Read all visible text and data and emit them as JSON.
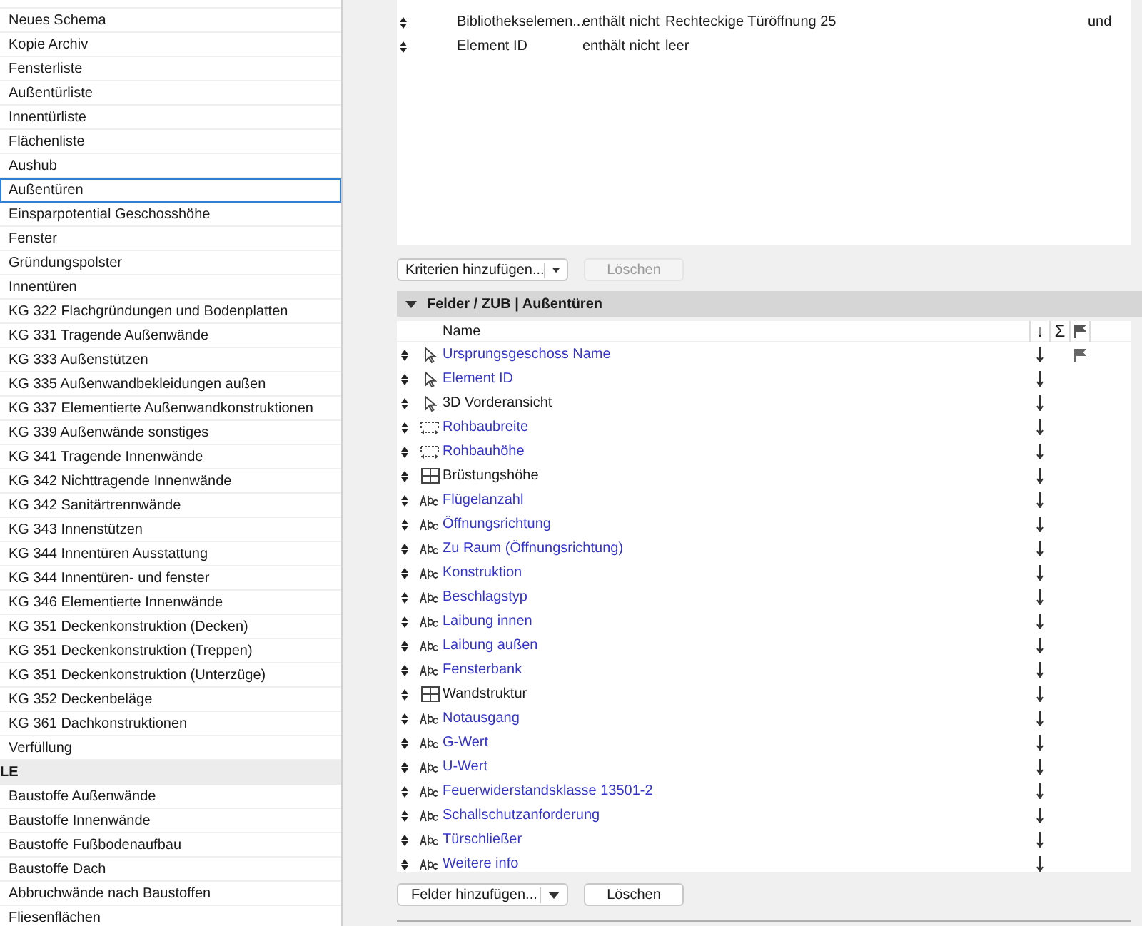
{
  "sidebar": {
    "items": [
      {
        "label": "Neues Schema",
        "kind": "item",
        "selected": false
      },
      {
        "label": "Kopie Archiv",
        "kind": "item",
        "selected": false
      },
      {
        "label": "Fensterliste",
        "kind": "item",
        "selected": false
      },
      {
        "label": "Außentürliste",
        "kind": "item",
        "selected": false
      },
      {
        "label": "Innentürliste",
        "kind": "item",
        "selected": false
      },
      {
        "label": "Flächenliste",
        "kind": "item",
        "selected": false
      },
      {
        "label": "Aushub",
        "kind": "item",
        "selected": false
      },
      {
        "label": "Außentüren",
        "kind": "item",
        "selected": true
      },
      {
        "label": "Einsparpotential Geschosshöhe",
        "kind": "item",
        "selected": false
      },
      {
        "label": "Fenster",
        "kind": "item",
        "selected": false
      },
      {
        "label": "Gründungspolster",
        "kind": "item",
        "selected": false
      },
      {
        "label": "Innentüren",
        "kind": "item",
        "selected": false
      },
      {
        "label": "KG 322 Flachgründungen und Bodenplatten",
        "kind": "item",
        "selected": false
      },
      {
        "label": "KG 331 Tragende Außenwände",
        "kind": "item",
        "selected": false
      },
      {
        "label": "KG 333 Außenstützen",
        "kind": "item",
        "selected": false
      },
      {
        "label": "KG 335 Außenwandbekleidungen außen",
        "kind": "item",
        "selected": false
      },
      {
        "label": "KG 337 Elementierte Außenwandkonstruktionen",
        "kind": "item",
        "selected": false
      },
      {
        "label": "KG 339 Außenwände sonstiges",
        "kind": "item",
        "selected": false
      },
      {
        "label": "KG 341 Tragende Innenwände",
        "kind": "item",
        "selected": false
      },
      {
        "label": "KG 342 Nichttragende Innenwände",
        "kind": "item",
        "selected": false
      },
      {
        "label": "KG 342 Sanitärtrennwände",
        "kind": "item",
        "selected": false
      },
      {
        "label": "KG 343 Innenstützen",
        "kind": "item",
        "selected": false
      },
      {
        "label": "KG 344 Innentüren Ausstattung",
        "kind": "item",
        "selected": false
      },
      {
        "label": "KG 344 Innentüren- und fenster",
        "kind": "item",
        "selected": false
      },
      {
        "label": "KG 346 Elementierte Innenwände",
        "kind": "item",
        "selected": false
      },
      {
        "label": "KG 351 Deckenkonstruktion (Decken)",
        "kind": "item",
        "selected": false
      },
      {
        "label": "KG 351 Deckenkonstruktion (Treppen)",
        "kind": "item",
        "selected": false
      },
      {
        "label": "KG 351 Deckenkonstruktion (Unterzüge)",
        "kind": "item",
        "selected": false
      },
      {
        "label": "KG 352 Deckenbeläge",
        "kind": "item",
        "selected": false
      },
      {
        "label": "KG 361 Dachkonstruktionen",
        "kind": "item",
        "selected": false
      },
      {
        "label": "Verfüllung",
        "kind": "item",
        "selected": false
      },
      {
        "label": "LE",
        "kind": "group"
      },
      {
        "label": "Baustoffe Außenwände",
        "kind": "item",
        "selected": false
      },
      {
        "label": "Baustoffe Innenwände",
        "kind": "item",
        "selected": false
      },
      {
        "label": "Baustoffe Fußbodenaufbau",
        "kind": "item",
        "selected": false
      },
      {
        "label": "Baustoffe Dach",
        "kind": "item",
        "selected": false
      },
      {
        "label": "Abbruchwände nach Baustoffen",
        "kind": "item",
        "selected": false
      },
      {
        "label": "Fliesenflächen",
        "kind": "item",
        "selected": false
      }
    ]
  },
  "criteria": {
    "rows": [
      {
        "field": "Bibliothekselemen...",
        "operator": "enthält nicht",
        "value": "Rechteckige Türöffnung 25",
        "conjunction": "und"
      },
      {
        "field": "Element ID",
        "operator": "enthält nicht",
        "value": "leer"
      }
    ],
    "add_button": "Kriterien hinzufügen...",
    "delete_button": {
      "label": "Löschen",
      "disabled": true
    }
  },
  "fields": {
    "title": "Felder / ZUB | Außentüren",
    "expanded": true,
    "columns": {
      "name": "Name",
      "sort": "↓",
      "sum": "Σ"
    },
    "rows": [
      {
        "kind": "pointer",
        "name": "Ursprungsgeschoss Name",
        "color": "#3333cc",
        "flagged": true
      },
      {
        "kind": "pointer",
        "name": "Element ID",
        "color": "#3333cc",
        "flagged": false
      },
      {
        "kind": "pointer",
        "name": "3D Vorderansicht",
        "color": "#1a1a1a",
        "flagged": false
      },
      {
        "kind": "dimension",
        "name": "Rohbaubreite",
        "color": "#3333cc",
        "flagged": false
      },
      {
        "kind": "dimension",
        "name": "Rohbauhöhe",
        "color": "#3333cc",
        "flagged": false
      },
      {
        "kind": "grid",
        "name": "Brüstungshöhe",
        "color": "#1a1a1a",
        "flagged": false
      },
      {
        "kind": "text",
        "name": "Flügelanzahl",
        "color": "#3333cc",
        "flagged": false
      },
      {
        "kind": "text",
        "name": "Öffnungsrichtung",
        "color": "#3333cc",
        "flagged": false
      },
      {
        "kind": "text",
        "name": "Zu Raum (Öffnungsrichtung)",
        "color": "#3333cc",
        "flagged": false
      },
      {
        "kind": "text",
        "name": "Konstruktion",
        "color": "#3333cc",
        "flagged": false
      },
      {
        "kind": "text",
        "name": "Beschlagstyp",
        "color": "#3333cc",
        "flagged": false
      },
      {
        "kind": "text",
        "name": "Laibung innen",
        "color": "#3333cc",
        "flagged": false
      },
      {
        "kind": "text",
        "name": "Laibung außen",
        "color": "#3333cc",
        "flagged": false
      },
      {
        "kind": "text",
        "name": "Fensterbank",
        "color": "#3333cc",
        "flagged": false
      },
      {
        "kind": "grid",
        "name": "Wandstruktur",
        "color": "#1a1a1a",
        "flagged": false
      },
      {
        "kind": "text",
        "name": "Notausgang",
        "color": "#3333cc",
        "flagged": false
      },
      {
        "kind": "text",
        "name": "G-Wert",
        "color": "#3333cc",
        "flagged": false
      },
      {
        "kind": "text",
        "name": "U-Wert",
        "color": "#3333cc",
        "flagged": false
      },
      {
        "kind": "text",
        "name": "Feuerwiderstandsklasse 13501-2",
        "color": "#3333cc",
        "flagged": false
      },
      {
        "kind": "text",
        "name": "Schallschutzanforderung",
        "color": "#3333cc",
        "flagged": false
      },
      {
        "kind": "text",
        "name": "Türschließer",
        "color": "#3333cc",
        "flagged": false
      },
      {
        "kind": "text",
        "name": "Weitere info",
        "color": "#3333cc",
        "flagged": false
      }
    ],
    "add_button": "Felder hinzufügen...",
    "delete_button": {
      "label": "Löschen",
      "disabled": false
    }
  }
}
